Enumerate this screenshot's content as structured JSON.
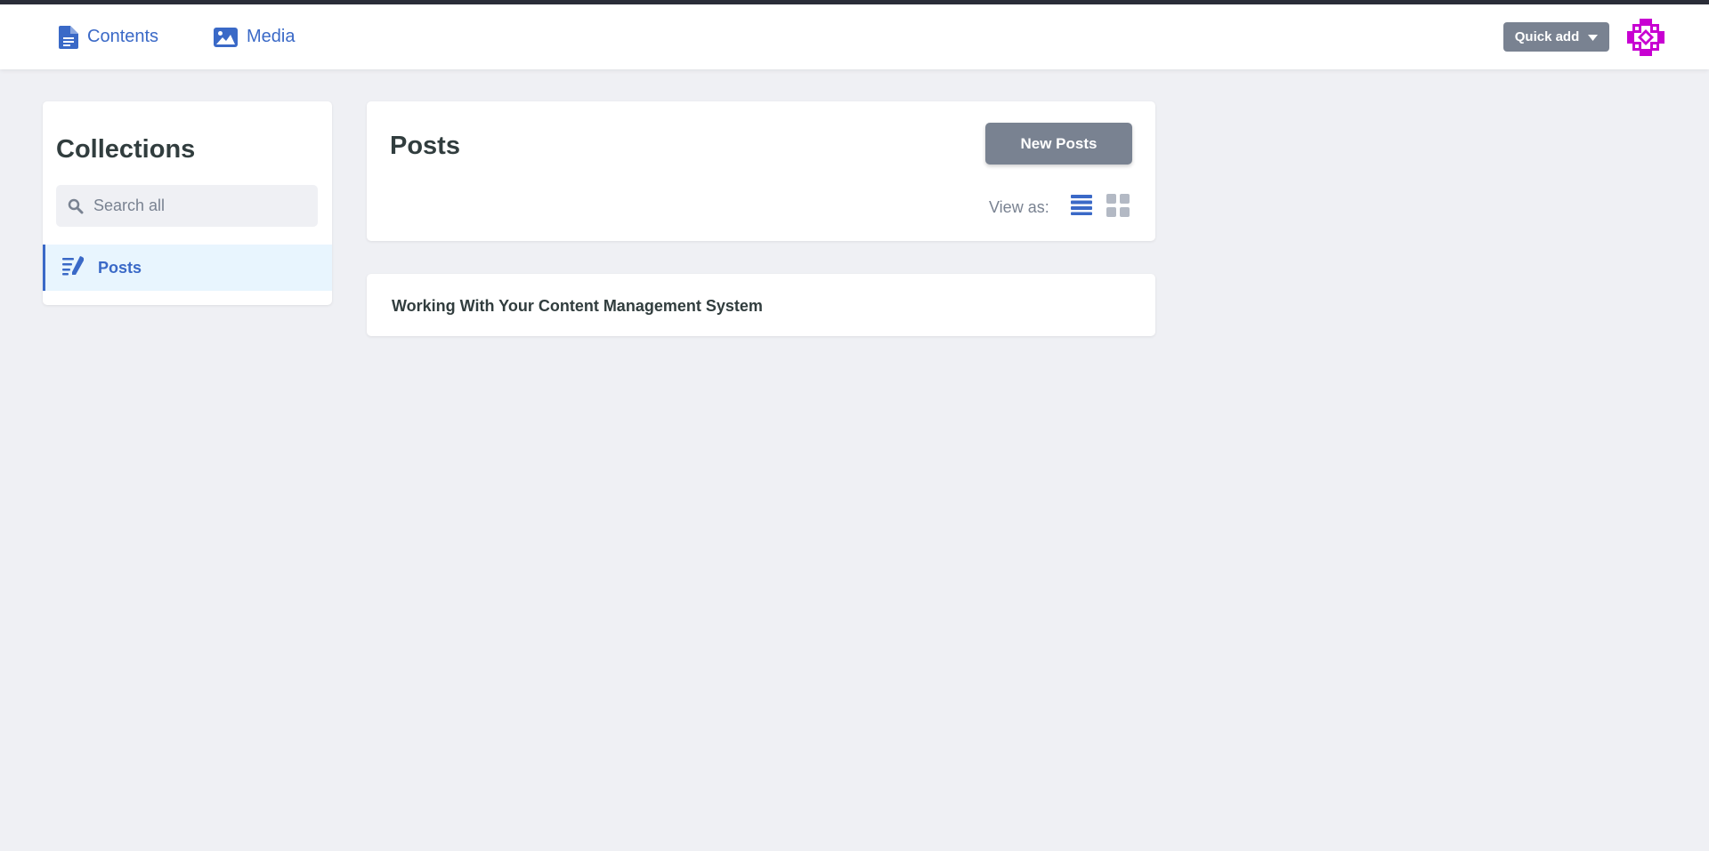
{
  "nav": {
    "contents_label": "Contents",
    "media_label": "Media",
    "quick_add_label": "Quick add"
  },
  "sidebar": {
    "title": "Collections",
    "search_placeholder": "Search all",
    "items": [
      {
        "label": "Posts",
        "active": true
      }
    ]
  },
  "main": {
    "title": "Posts",
    "new_button_label": "New Posts",
    "view_as_label": "View as:",
    "view_mode": "list",
    "entries": [
      {
        "title": "Working With Your Content Management System"
      }
    ]
  },
  "colors": {
    "accent": "#3a69c7",
    "button_gray": "#798291",
    "background": "#eff0f4",
    "active_item_bg": "#e8f5fe",
    "avatar": "#c800d2"
  },
  "icons": {
    "contents": "document-icon",
    "media": "image-icon",
    "quick_add": "caret-down-icon",
    "search": "search-icon",
    "posts": "pen-lines-icon",
    "view_list": "list-view-icon",
    "view_grid": "grid-view-icon"
  }
}
